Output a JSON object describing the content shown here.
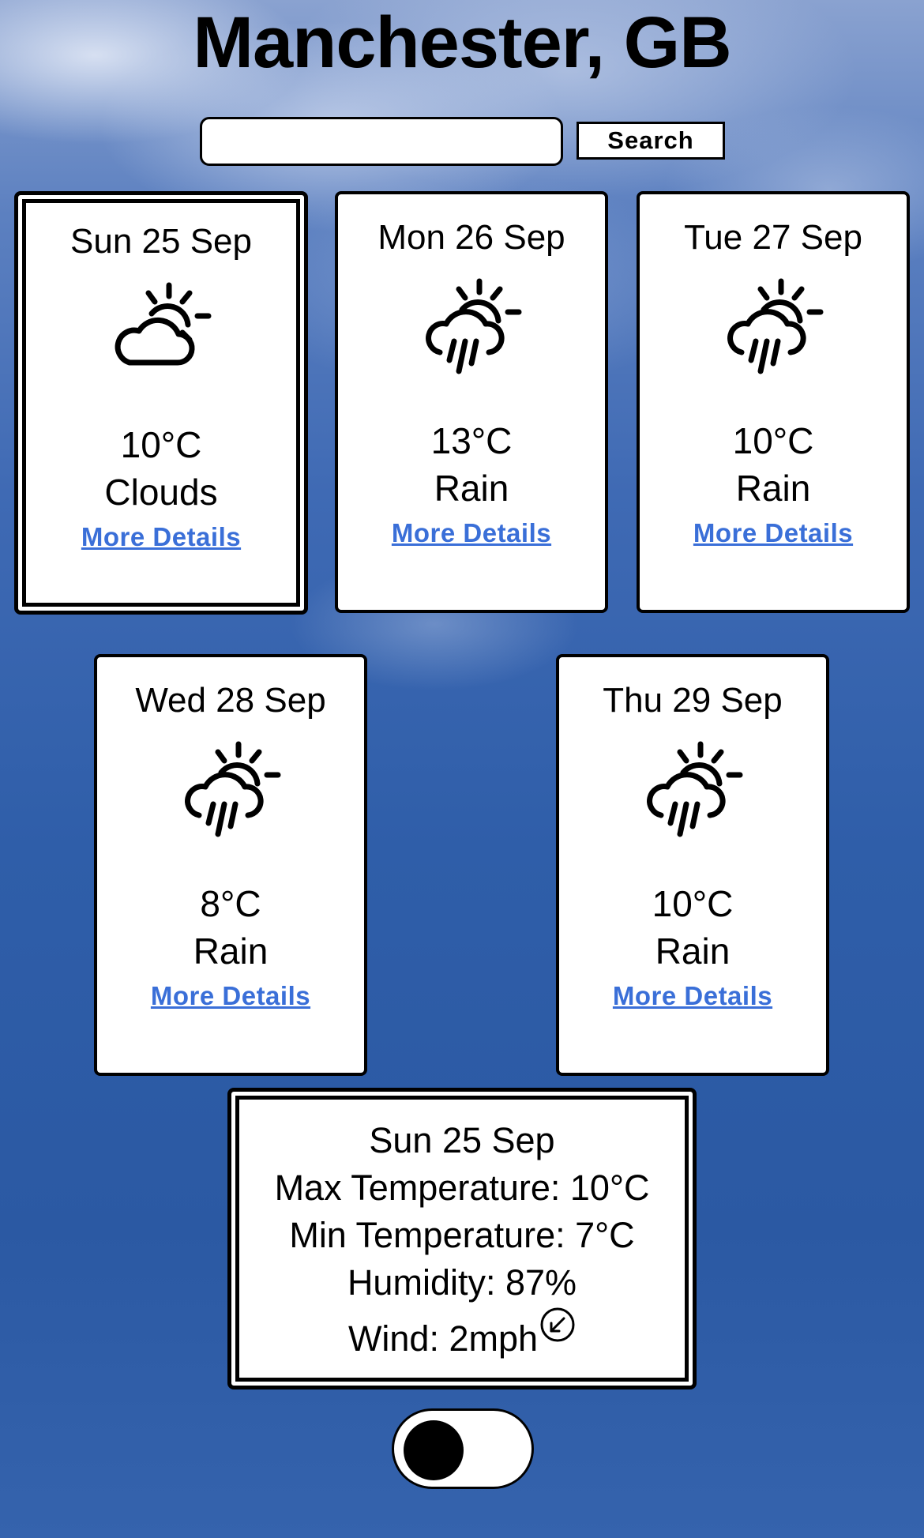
{
  "header": {
    "title": "Manchester, GB"
  },
  "search": {
    "placeholder": "",
    "value": "",
    "button_label": "Search"
  },
  "forecast": [
    {
      "date": "Sun 25 Sep",
      "icon": "cloudy-sun-icon",
      "temp": "10°C",
      "condition": "Clouds",
      "link": "More Details",
      "selected": true
    },
    {
      "date": "Mon 26 Sep",
      "icon": "rain-sun-icon",
      "temp": "13°C",
      "condition": "Rain",
      "link": "More Details",
      "selected": false
    },
    {
      "date": "Tue 27 Sep",
      "icon": "rain-sun-icon",
      "temp": "10°C",
      "condition": "Rain",
      "link": "More Details",
      "selected": false
    },
    {
      "date": "Wed 28 Sep",
      "icon": "rain-sun-icon",
      "temp": "8°C",
      "condition": "Rain",
      "link": "More Details",
      "selected": false
    },
    {
      "date": "Thu 29 Sep",
      "icon": "rain-sun-icon",
      "temp": "10°C",
      "condition": "Rain",
      "link": "More Details",
      "selected": false
    }
  ],
  "details": {
    "date": "Sun 25 Sep",
    "max_temp": "Max Temperature: 10°C",
    "min_temp": "Min Temperature: 7°C",
    "humidity": "Humidity: 87%",
    "wind": "Wind: 2mph",
    "wind_icon": "wind-direction-arrow-icon"
  },
  "theme_toggle": {
    "state": "off"
  },
  "colors": {
    "link": "#3a6fd8",
    "card_bg": "#ffffff",
    "border": "#000000"
  }
}
